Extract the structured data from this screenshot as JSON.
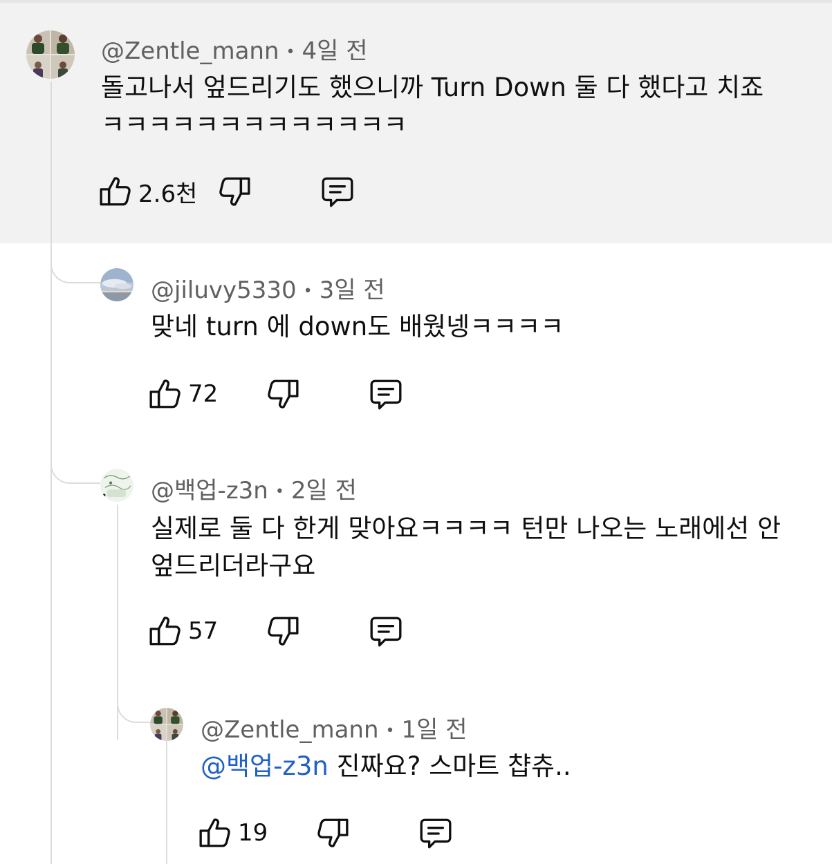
{
  "comments": [
    {
      "author": "@Zentle_mann",
      "separator": "•",
      "time": "4일 전",
      "text": "돌고나서 엎드리기도 했으니까 Turn Down 둘 다 했다고 치죠",
      "text2": "ㅋㅋㅋㅋㅋㅋㅋㅋㅋㅋㅋㅋㅋ",
      "likes": "2.6천",
      "avatar": "photo-avatar",
      "highlighted": true
    },
    {
      "author": "@jiluvy5330",
      "separator": "•",
      "time": "3일 전",
      "text": "맞네 turn 에 down도 배웠넹ㅋㅋㅋㅋ",
      "likes": "72",
      "avatar": "sky-avatar"
    },
    {
      "author": "@백업-z3n",
      "separator": "•",
      "time": "2일 전",
      "text": "실제로 둘 다 한게 맞아요ㅋㅋㅋㅋ 턴만 나오는 노래에선 안",
      "text2": "엎드리더라구요",
      "likes": "57",
      "avatar": "sketch-avatar"
    },
    {
      "author": "@Zentle_mann",
      "separator": "•",
      "time": "1일 전",
      "mention": "@백업-z3n",
      "text": " 진짜요? 스마트 챱츄..",
      "likes": "19",
      "avatar": "photo-avatar"
    }
  ],
  "icons": {
    "like": "thumbs-up-icon",
    "dislike": "thumbs-down-icon",
    "reply": "reply-icon"
  },
  "colors": {
    "highlight_bg": "#f2f2f2",
    "mention": "#2160c4",
    "meta_text": "#606060"
  }
}
